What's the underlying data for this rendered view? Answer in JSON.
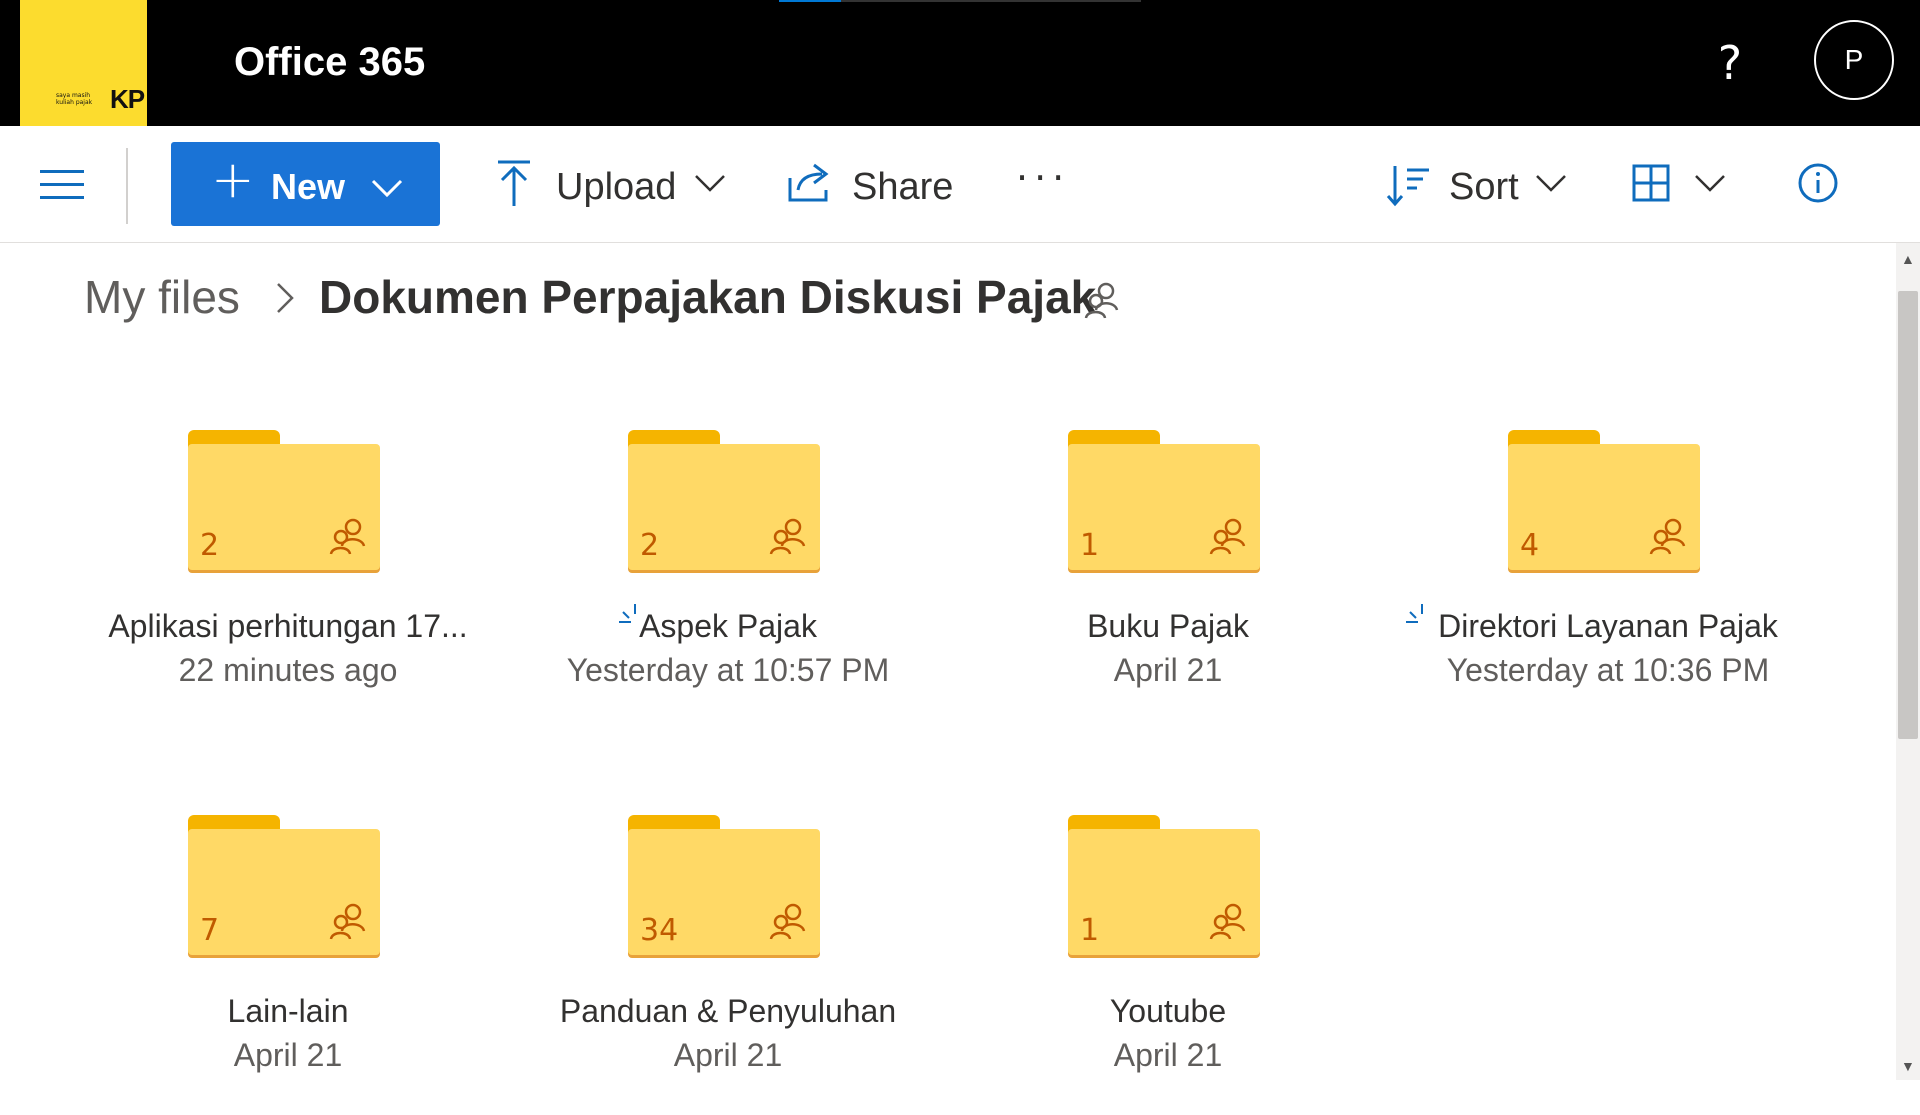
{
  "header": {
    "brand": {
      "logo_text": "KP",
      "tagline": "saya masih kuliah pajak"
    },
    "app_title": "Office 365",
    "help_glyph": "?",
    "avatar_initial": "P",
    "loading_progress": 0.17
  },
  "toolbar": {
    "new_label": "New",
    "upload_label": "Upload",
    "share_label": "Share",
    "more_label": "···",
    "sort_label": "Sort",
    "view_icon": "grid-view-icon",
    "info_icon": "info-icon"
  },
  "breadcrumb": {
    "root": "My files",
    "current": "Dokumen Perpajakan Diskusi Pajak"
  },
  "colors": {
    "header_bg": "#000000",
    "brand_yellow": "#fcdc2e",
    "accent": "#1a73d6",
    "folder_body": "#ffd966",
    "folder_tab": "#f5b400",
    "folder_count": "#c05a00"
  },
  "folders": [
    {
      "name": "Aplikasi perhitungan 17...",
      "modified": "22 minutes ago",
      "count": "2",
      "shared": true,
      "new_badge": false
    },
    {
      "name": "Aspek Pajak",
      "modified": "Yesterday at 10:57 PM",
      "count": "2",
      "shared": true,
      "new_badge": true
    },
    {
      "name": "Buku Pajak",
      "modified": "April 21",
      "count": "1",
      "shared": true,
      "new_badge": false
    },
    {
      "name": "Direktori Layanan Pajak",
      "modified": "Yesterday at 10:36 PM",
      "count": "4",
      "shared": true,
      "new_badge": true
    },
    {
      "name": "Lain-lain",
      "modified": "April 21",
      "count": "7",
      "shared": true,
      "new_badge": false
    },
    {
      "name": "Panduan & Penyuluhan",
      "modified": "April 21",
      "count": "34",
      "shared": true,
      "new_badge": false
    },
    {
      "name": "Youtube",
      "modified": "April 21",
      "count": "1",
      "shared": true,
      "new_badge": false
    }
  ]
}
